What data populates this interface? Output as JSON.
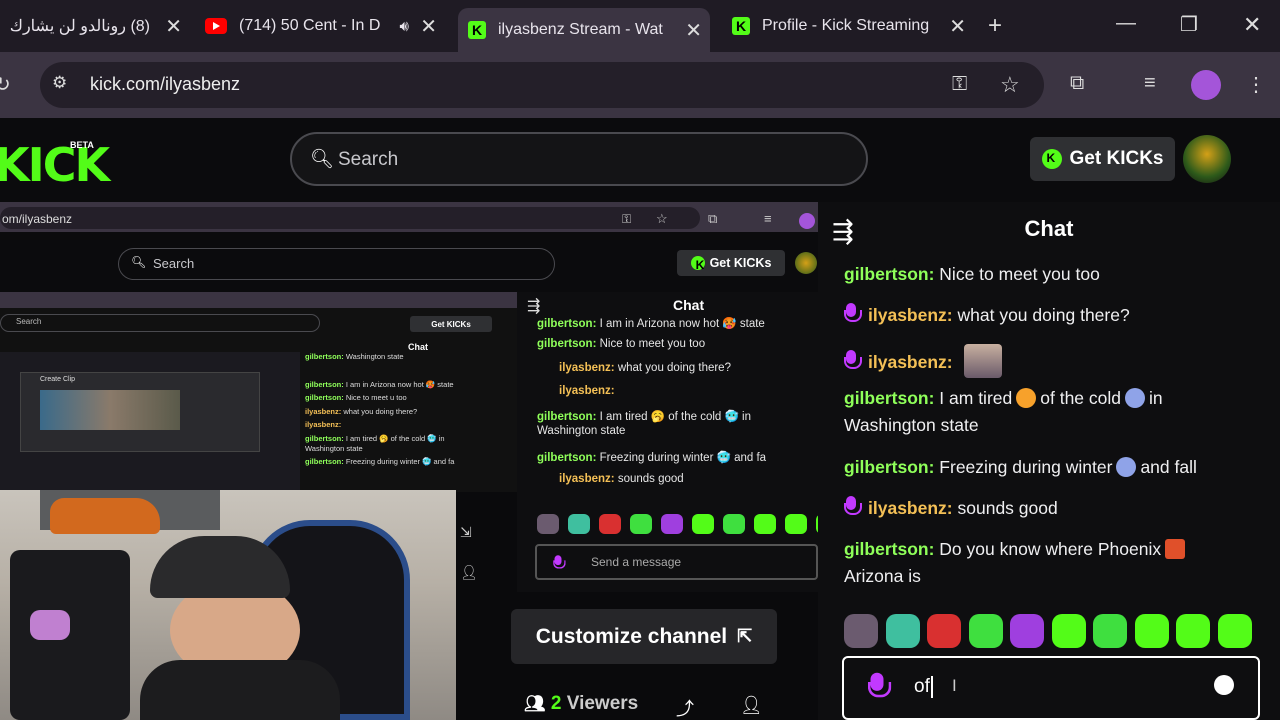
{
  "tabs": [
    {
      "title": "(8) رونالدو لن يشارك",
      "close": "✕"
    },
    {
      "title": "(714) 50 Cent - In D",
      "close": "✕"
    },
    {
      "title": "ilyasbenz Stream - Wat",
      "close": "✕"
    },
    {
      "title": "Profile - Kick Streaming",
      "close": "✕"
    }
  ],
  "new_tab": "+",
  "window": {
    "minimize": "—",
    "restore": "❐",
    "close": "✕"
  },
  "address": {
    "url": "kick.com/ilyasbenz"
  },
  "kick": {
    "logo": "KICK",
    "beta": "BETA",
    "search_placeholder": "Search",
    "get_kicks": "Get KICKs"
  },
  "nested": {
    "url": "om/ilyasbenz",
    "search": "Search",
    "get_kicks": "Get KICKs",
    "chat_title": "Chat",
    "send_placeholder": "Send a message",
    "customize": "Customize channel",
    "viewers_count": "2",
    "viewers_label": "Viewers",
    "messages": [
      {
        "user": "gilbertson:",
        "text": "I am in Arizona now hot 🥵 state"
      },
      {
        "user": "gilbertson:",
        "text": "Nice to meet you too"
      },
      {
        "user": "ilyasbenz:",
        "text": "what you doing there?"
      },
      {
        "user": "ilyasbenz:",
        "text": ""
      },
      {
        "user": "gilbertson:",
        "text": "I am tired 🥱 of the cold 🥶 in"
      },
      {
        "text": "Washington state"
      },
      {
        "user": "gilbertson:",
        "text": "Freezing during winter 🥶 and fa"
      },
      {
        "user": "ilyasbenz:",
        "text": "sounds good"
      }
    ],
    "inner": {
      "search": "Search",
      "get_kicks": "Get KICKs",
      "chat_title": "Chat",
      "create_clip": "Create Clip",
      "messages": [
        {
          "user": "gilbertson:",
          "text": "Washington state"
        },
        {
          "user": "gilbertson:",
          "text": "I am in Arizona now hot 🥵 state"
        },
        {
          "user": "gilbertson:",
          "text": "Nice to meet u too"
        },
        {
          "user": "ilyasbenz:",
          "text": "what you doing there?"
        },
        {
          "user": "ilyasbenz:",
          "text": ""
        },
        {
          "user": "gilbertson:",
          "text": "I am tired 🥱 of the cold 🥶 in"
        },
        {
          "text": "Washington state"
        },
        {
          "user": "gilbertson:",
          "text": "Freezing during winter 🥶 and fa"
        }
      ]
    }
  },
  "chat": {
    "title": "Chat",
    "messages": [
      {
        "user": "gilbertson:",
        "text": "Nice to meet you too"
      },
      {
        "user": "ilyasbenz:",
        "text": "what you doing there?"
      },
      {
        "user": "ilyasbenz:",
        "text": ""
      },
      {
        "user": "gilbertson:",
        "text1": "I am tired",
        "text2": "of the cold",
        "text3": "in",
        "text4": "Washington state"
      },
      {
        "user": "gilbertson:",
        "text1": "Freezing during winter",
        "text2": "and fall"
      },
      {
        "user": "ilyasbenz:",
        "text": "sounds good"
      },
      {
        "user": "gilbertson:",
        "text1": "Do you know where Phoenix",
        "text2": "Arizona is"
      }
    ],
    "input_value": "of",
    "emote_colors": [
      "#6b5b6f",
      "#3fbf9f",
      "#d93030",
      "#3fdf3f",
      "#9f3fdf",
      "#53fc18",
      "#3fdf3f",
      "#53fc18",
      "#53fc18",
      "#53fc18"
    ]
  }
}
